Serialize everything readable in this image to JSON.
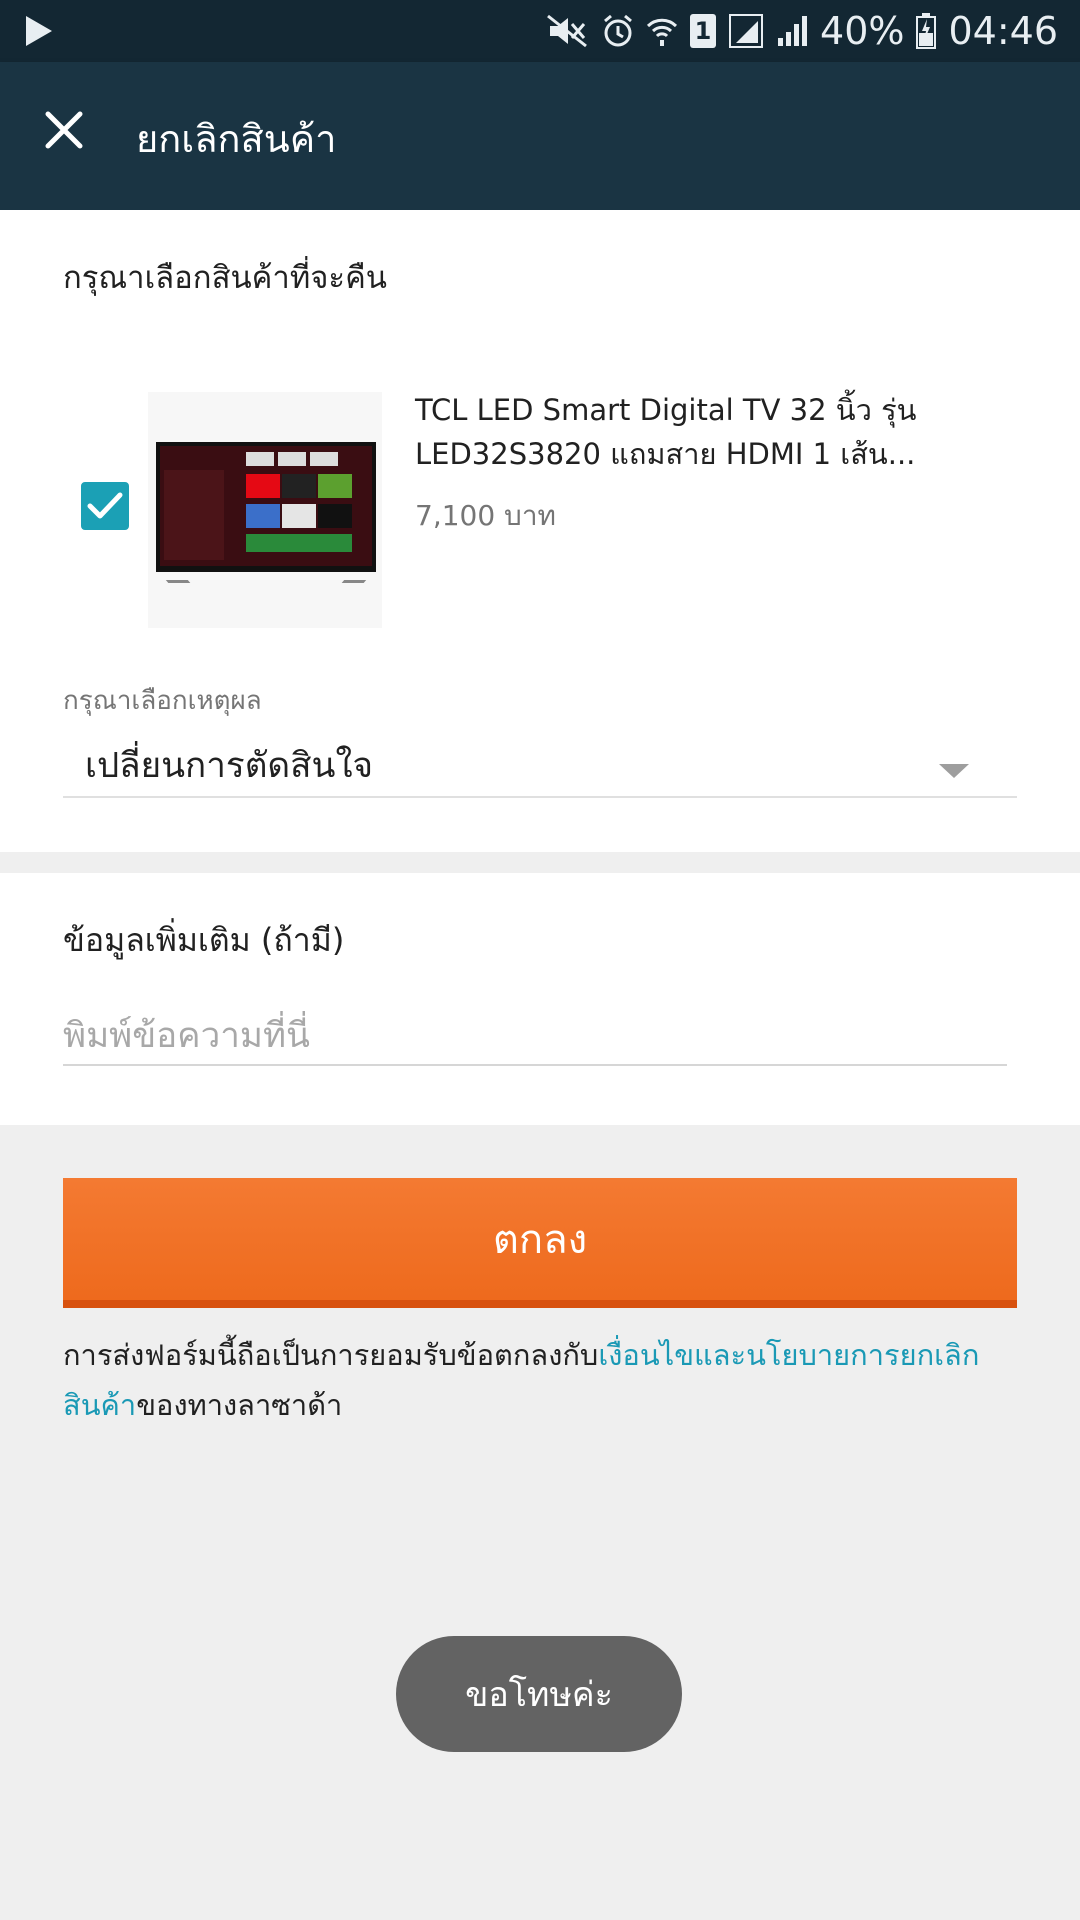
{
  "status_bar": {
    "battery_percent": "40%",
    "time": "04:46",
    "sim_number": "1",
    "icons": [
      "play-icon",
      "mute-icon",
      "alarm-icon",
      "wifi-icon",
      "sim-icon",
      "signal-icon",
      "signal-icon",
      "battery-icon"
    ]
  },
  "toolbar": {
    "close_icon": "close-icon",
    "title": "ยกเลิกสินค้า"
  },
  "product_section": {
    "title": "กรุณาเลือกสินค้าที่จะคืน",
    "item": {
      "checked": true,
      "name": "TCL LED Smart Digital TV 32 นิ้ว รุ่น LED32S3820 แถมสาย HDMI 1 เส้น...",
      "price": "7,100 บาท"
    },
    "reason_label": "กรุณาเลือกเหตุผล",
    "reason_value": "เปลี่ยนการตัดสินใจ"
  },
  "extra_section": {
    "title": "ข้อมูลเพิ่มเติม (ถ้ามี)",
    "placeholder": "พิมพ์ข้อความที่นี่",
    "value": ""
  },
  "submit": {
    "label": "ตกลง"
  },
  "terms": {
    "prefix": "การส่งฟอร์มนี้ถือเป็นการยอมรับข้อตกลงกับ",
    "link": "เงื่อนไขและนโยบายการยกเลิกสินค้า",
    "suffix": "ของทางลาซาด้า"
  },
  "toast": {
    "message": "ขอโทษค่ะ"
  },
  "colors": {
    "toolbar": "#1a3443",
    "status_bar": "#132733",
    "accent_orange": "#f47a32",
    "checkbox": "#1ba0b5",
    "link": "#1a99b5"
  }
}
